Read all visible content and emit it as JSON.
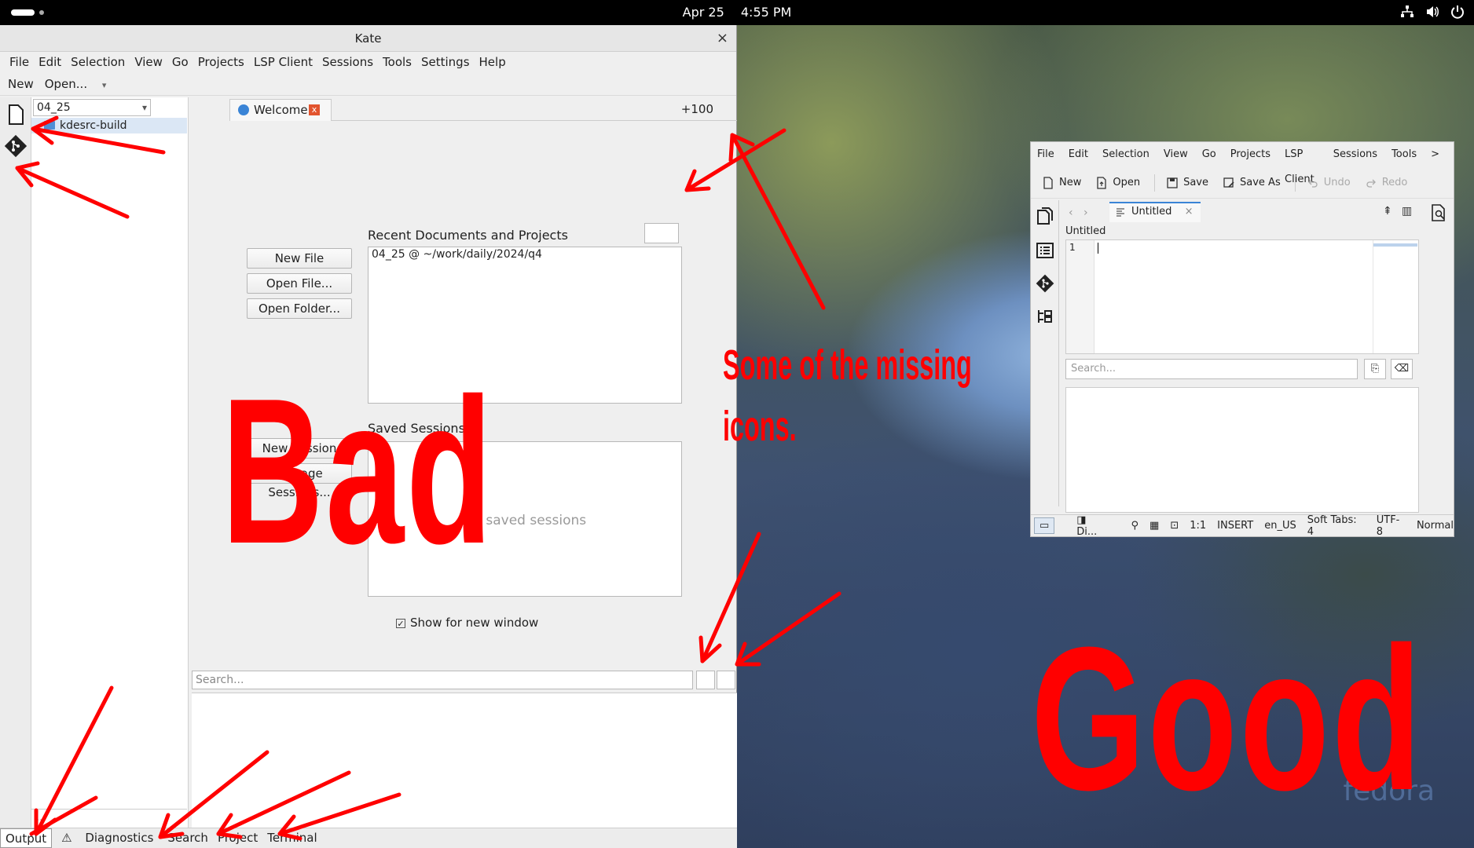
{
  "topbar": {
    "date": "Apr 25",
    "time": "4:55 PM"
  },
  "kate": {
    "title": "Kate",
    "close_glyph": "×",
    "menu": [
      "File",
      "Edit",
      "Selection",
      "View",
      "Go",
      "Projects",
      "LSP Client",
      "Sessions",
      "Tools",
      "Settings",
      "Help"
    ],
    "toolbar": {
      "new": "New",
      "open": "Open..."
    },
    "sidebar": {
      "combo_value": "04_25",
      "selected_item": "kdesrc-build",
      "filter_placeholder": "..."
    },
    "tab": {
      "label": "Welcome",
      "close_glyph": "x"
    },
    "zoom": "+100",
    "welcome": {
      "buttons": [
        "New File",
        "Open File...",
        "Open Folder..."
      ],
      "recent_title": "Recent Documents and Projects",
      "recent_items": [
        "04_25 @ ~/work/daily/2024/q4"
      ],
      "sessions_title": "Saved Sessions",
      "session_buttons": [
        "New Session",
        "Manage Sessions..."
      ],
      "sessions_empty": "No saved sessions",
      "show_checkbox": "Show for new window",
      "checked_glyph": "✓"
    },
    "search_placeholder": "Search...",
    "bottom_tabs": [
      "Output",
      "Diagnostics",
      "Search",
      "Project",
      "Terminal"
    ]
  },
  "good": {
    "menu": [
      "File",
      "Edit",
      "Selection",
      "View",
      "Go",
      "Projects",
      "LSP Client",
      "Sessions",
      "Tools"
    ],
    "more_glyph": ">",
    "toolbar": [
      "New",
      "Open",
      "Save",
      "Save As",
      "Undo",
      "Redo"
    ],
    "tab_label": "Untitled",
    "tab_close": "×",
    "filename": "Untitled",
    "line_number": "1",
    "search_placeholder": "Search...",
    "status": [
      "Di...",
      "1:1",
      "INSERT",
      "en_US",
      "Soft Tabs: 4",
      "UTF-8",
      "Normal"
    ]
  },
  "annotations": {
    "bad": "Bad",
    "good": "Good",
    "note_line1": "Some of the missing",
    "note_line2": "icons.",
    "color": "#ff0000"
  },
  "wallpaper": {
    "watermark": "fedora"
  }
}
